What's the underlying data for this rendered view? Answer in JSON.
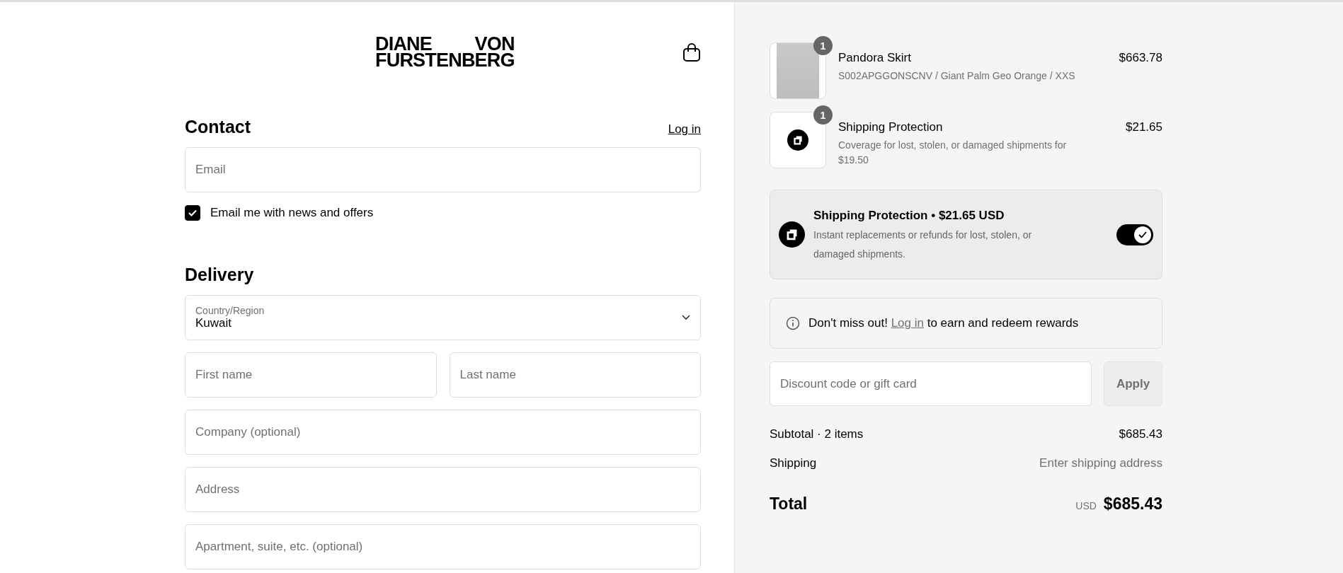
{
  "header": {
    "logo": [
      "DIANE",
      "VON",
      "FURSTENBERG"
    ]
  },
  "contact": {
    "title": "Contact",
    "login_link": "Log in",
    "email": {
      "placeholder": "Email"
    },
    "newsletter": {
      "label": "Email me with news and offers",
      "checked": true
    }
  },
  "delivery": {
    "title": "Delivery",
    "country": {
      "label": "Country/Region",
      "value": "Kuwait"
    },
    "fields": [
      {
        "placeholder": "First name",
        "half": true
      },
      {
        "placeholder": "Last name",
        "half": true
      },
      {
        "placeholder": "Company (optional)",
        "half": false
      },
      {
        "placeholder": "Address",
        "half": false
      },
      {
        "placeholder": "Apartment, suite, etc. (optional)",
        "half": false
      }
    ]
  },
  "order": {
    "items": [
      {
        "kind": "photo",
        "quantity": "1",
        "name": "Pandora Skirt",
        "detail": "S002APGGONSCNV / Giant Palm Geo Orange / XXS",
        "price": "$663.78"
      },
      {
        "kind": "logo",
        "quantity": "1",
        "name": "Shipping Protection",
        "detail": "Coverage for lost, stolen, or damaged shipments for $19.50",
        "price": "$21.65"
      }
    ],
    "protection": {
      "title": "Shipping Protection • $21.65 USD",
      "description": "Instant replacements or refunds for lost, stolen, or damaged shipments.",
      "on": true
    },
    "rewards": {
      "before": "Don't miss out!",
      "link": "Log in",
      "after": "to earn and redeem rewards"
    },
    "discount": {
      "placeholder": "Discount code or gift card",
      "button": "Apply"
    },
    "summary": [
      {
        "label": "Subtotal · 2 items",
        "value": "$685.43",
        "muted": false
      },
      {
        "label": "Shipping",
        "value": "Enter shipping address",
        "muted": true
      }
    ],
    "total": {
      "label": "Total",
      "currency": "USD",
      "value": "$685.43"
    }
  }
}
